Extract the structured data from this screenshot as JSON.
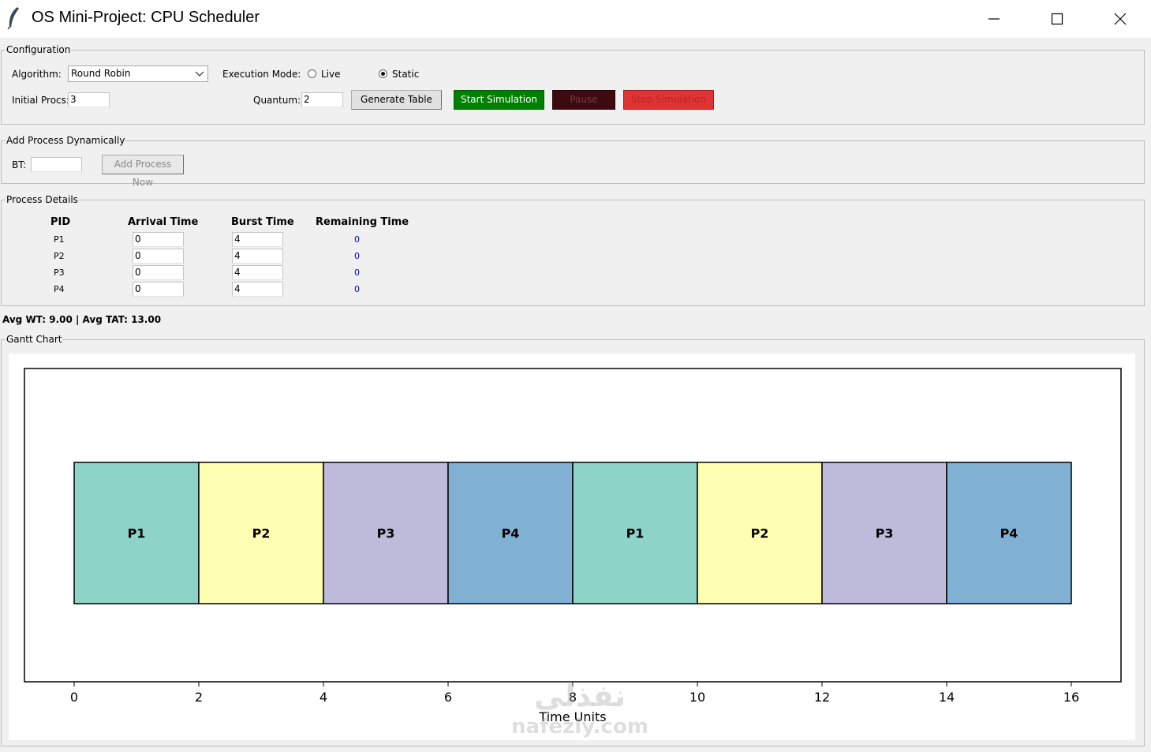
{
  "window": {
    "title": "OS Mini-Project: CPU Scheduler",
    "icon": "feather-icon",
    "controls": [
      "minimize-icon",
      "maximize-icon",
      "close-icon"
    ]
  },
  "configuration": {
    "label": "Configuration",
    "algorithm_label": "Algorithm:",
    "algorithm_value": "Round Robin",
    "mode_label": "Execution Mode:",
    "mode_live": "Live",
    "mode_static": "Static",
    "mode_selected": "Static",
    "initial_procs_label": "Initial Procs:",
    "initial_procs_value": "3",
    "quantum_label": "Quantum:",
    "quantum_value": "2",
    "generate_label": "Generate Table",
    "start_label": "Start Simulation",
    "pause_label": "Pause",
    "stop_label": "Stop Simulation",
    "colors": {
      "start": "#008000",
      "pause": "#3c0a0f",
      "stop": "#e03434"
    }
  },
  "add_process": {
    "label": "Add Process Dynamically",
    "bt_label": "BT:",
    "bt_value": "",
    "add_label": "Add Process Now"
  },
  "process_details": {
    "label": "Process Details",
    "columns": [
      "PID",
      "Arrival Time",
      "Burst Time",
      "Remaining Time"
    ],
    "rows": [
      {
        "pid": "P1",
        "arrival": "0",
        "burst": "4",
        "remaining": "0"
      },
      {
        "pid": "P2",
        "arrival": "0",
        "burst": "4",
        "remaining": "0"
      },
      {
        "pid": "P3",
        "arrival": "0",
        "burst": "4",
        "remaining": "0"
      },
      {
        "pid": "P4",
        "arrival": "0",
        "burst": "4",
        "remaining": "0"
      }
    ]
  },
  "averages": "Avg WT: 9.00 | Avg TAT: 13.00",
  "gantt": {
    "label": "Gantt Chart"
  },
  "chart_data": {
    "type": "bar",
    "orientation": "horizontal",
    "title": "",
    "xlabel": "Time Units",
    "ylabel": "",
    "xlim": [
      -2,
      42
    ],
    "xticks": [
      0,
      2,
      4,
      6,
      8,
      10,
      12,
      14,
      16
    ],
    "segments": [
      {
        "name": "P1",
        "start": 0,
        "end": 2,
        "color": "#8dd3c7"
      },
      {
        "name": "P2",
        "start": 2,
        "end": 4,
        "color": "#ffffb3"
      },
      {
        "name": "P3",
        "start": 4,
        "end": 6,
        "color": "#bebada"
      },
      {
        "name": "P4",
        "start": 6,
        "end": 8,
        "color": "#80b1d3"
      },
      {
        "name": "P1",
        "start": 8,
        "end": 10,
        "color": "#8dd3c7"
      },
      {
        "name": "P2",
        "start": 10,
        "end": 12,
        "color": "#ffffb3"
      },
      {
        "name": "P3",
        "start": 12,
        "end": 14,
        "color": "#bebada"
      },
      {
        "name": "P4",
        "start": 14,
        "end": 16,
        "color": "#80b1d3"
      }
    ],
    "grid": false,
    "legend": "none"
  },
  "watermark": {
    "arabic": "نفذلي",
    "latin": "nafezly.com"
  }
}
